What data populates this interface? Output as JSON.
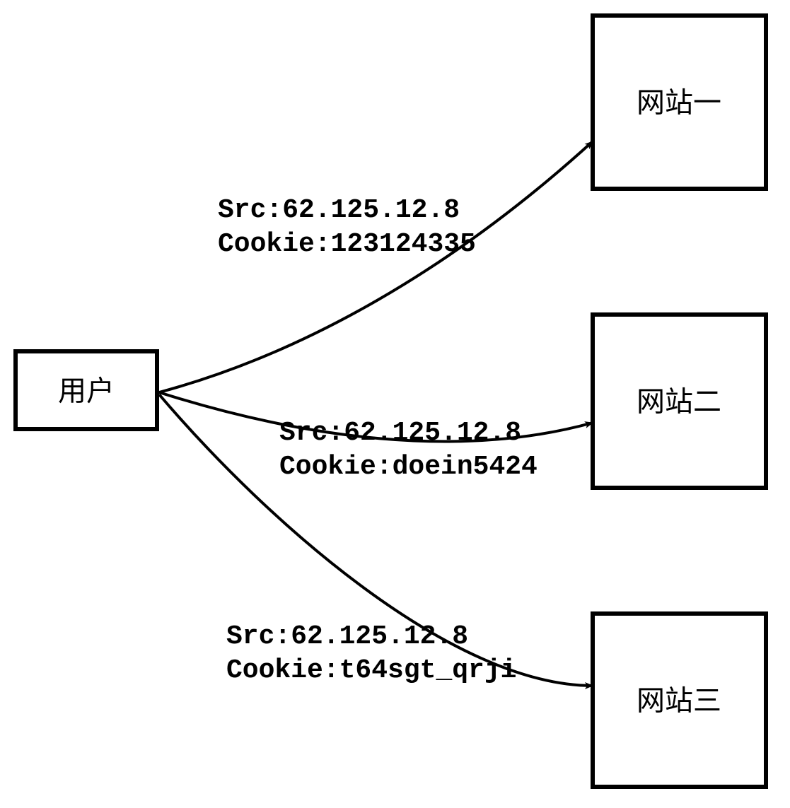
{
  "user": {
    "label": "用户"
  },
  "sites": [
    {
      "label": "网站一"
    },
    {
      "label": "网站二"
    },
    {
      "label": "网站三"
    }
  ],
  "edges": [
    {
      "src": "Src:62.125.12.8",
      "cookie": "Cookie:123124335"
    },
    {
      "src": "Src:62.125.12.8",
      "cookie": "Cookie:doein5424"
    },
    {
      "src": "Src:62.125.12.8",
      "cookie": "Cookie:t64sgt_qrji"
    }
  ]
}
